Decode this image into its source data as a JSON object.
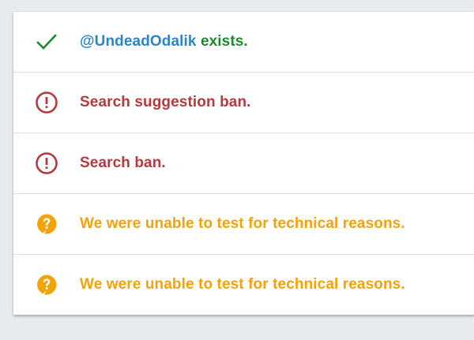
{
  "colors": {
    "background": "#e8ebee",
    "card": "#ffffff",
    "success": "#1e8a2e",
    "link": "#2a86c6",
    "danger": "#b43a3e",
    "warning": "#f4a20a"
  },
  "results": [
    {
      "status": "success",
      "icon": "checkmark-icon",
      "handle": "@UndeadOdalik",
      "text": " exists."
    },
    {
      "status": "danger",
      "icon": "exclamation-circle-icon",
      "text": "Search suggestion ban."
    },
    {
      "status": "danger",
      "icon": "exclamation-circle-icon",
      "text": "Search ban."
    },
    {
      "status": "warning",
      "icon": "question-bubble-icon",
      "text": "We were unable to test for technical reasons."
    },
    {
      "status": "warning",
      "icon": "question-bubble-icon",
      "text": "We were unable to test for technical reasons."
    }
  ]
}
